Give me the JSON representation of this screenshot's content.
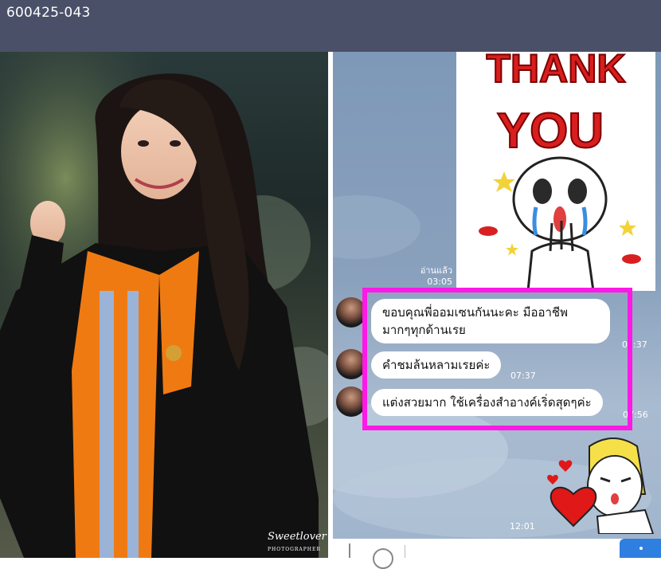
{
  "header": {
    "title": "600425-043"
  },
  "photo": {
    "watermark": "Sweetlover",
    "watermark_sub": "PHOTOGRAPHER"
  },
  "chat": {
    "sticker_text_1": "THANK",
    "sticker_text_2": "YOU",
    "read_label": "อ่านแล้ว",
    "read_time": "03:05",
    "messages": [
      {
        "text": "ขอบคุณพี่ออมเซนกันนะคะ มืออาชีพ มากๆทุกด้านเรย",
        "time": "07:37"
      },
      {
        "text": "คำชมล้นหลามเรยค่ะ",
        "time": "07:37"
      },
      {
        "text": "แต่งสวยมาก ใช้เครื่องสำอางค์เริ่ดสุดๆค่ะ",
        "time": "07:56"
      }
    ],
    "last_sticker_time": "12:01"
  },
  "colors": {
    "highlight": "#ff19e6",
    "topbar": "#4a5068",
    "send_button": "#2f7fe0"
  }
}
